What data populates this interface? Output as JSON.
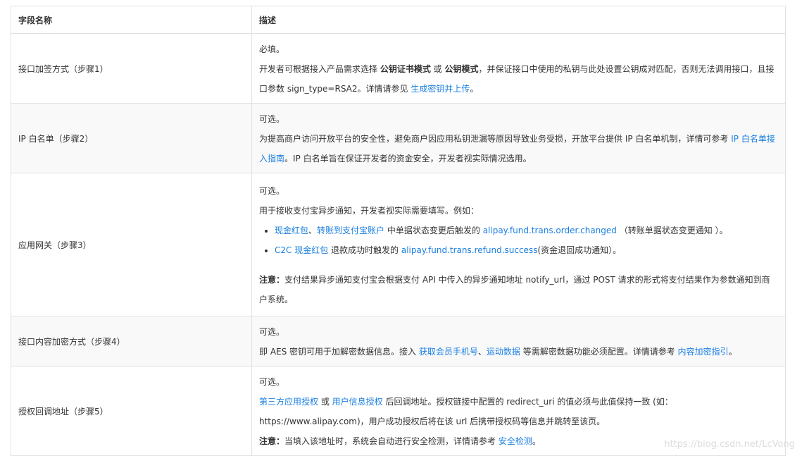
{
  "header": {
    "col_name": "字段名称",
    "col_desc": "描述"
  },
  "rows": [
    {
      "name": "接口加签方式（步骤1）",
      "line1": "必填。",
      "line2_pre": "开发者可根据接入产品需求选择 ",
      "line2_b1": "公钥证书模式",
      "line2_mid": " 或 ",
      "line2_b2": "公钥模式",
      "line2_post": "，并保证接口中使用的私钥与此处设置公钥成对匹配，否则无法调用接口，且接口参数 sign_type=RSA2。详情请参见 ",
      "link": "生成密钥并上传",
      "line2_end": "。"
    },
    {
      "name": "IP 白名单（步骤2）",
      "line1": "可选。",
      "line2_pre": "为提高商户访问开放平台的安全性，避免商户因应用私钥泄漏等原因导致业务受损，开放平台提供 IP 白名单机制，详情可参考 ",
      "link": "IP 白名单接入指南",
      "line2_post": "。IP 白名单旨在保证开发者的资金安全，开发者视实际情况选用。"
    },
    {
      "name": "应用网关（步骤3）",
      "line1": "可选。",
      "line2": "用于接收支付宝异步通知，开发者视实际需要填写。例如：",
      "bullet1_link1": "现金红包",
      "bullet1_sep": "、",
      "bullet1_link2": "转账到支付宝账户",
      "bullet1_mid": " 中单据状态变更后触发的 ",
      "bullet1_link3": "alipay.fund.trans.order.changed",
      "bullet1_post": " （转账单据状态变更通知 ）。",
      "bullet2_link1": "C2C 现金红包",
      "bullet2_mid": " 退款成功时触发的 ",
      "bullet2_link2": "alipay.fund.trans.refund.success",
      "bullet2_post": "(资金退回成功通知）。",
      "note_label": "注意：",
      "note_text": "支付结果异步通知支付宝会根据支付 API 中传入的异步通知地址 notify_url，通过 POST 请求的形式将支付结果作为参数通知到商户系统。"
    },
    {
      "name": "接口内容加密方式（步骤4）",
      "line1": "可选。",
      "line2_pre": "即 AES 密钥可用于加解密数据信息。接入 ",
      "link1": "获取会员手机号",
      "sep": "、",
      "link2": "运动数据",
      "line2_mid": " 等需解密数据功能必须配置。详情请参考 ",
      "link3": "内容加密指引",
      "line2_end": "。"
    },
    {
      "name": "授权回调地址（步骤5）",
      "line1": "可选。",
      "link1": "第三方应用授权",
      "mid1": " 或 ",
      "link2": "用户信息授权",
      "line2_post": " 后回调地址。授权链接中配置的 redirect_uri 的值必须与此值保持一致 (如：https://www.alipay.com)，用户成功授权后将在该 url 后携带授权码等信息并跳转至该页。",
      "note_label": "注意：",
      "note_text": "当填入该地址时，系统会自动进行安全检测，详情请参考 ",
      "note_link": "安全检测",
      "note_end": "。"
    }
  ],
  "watermark": "https://blog.csdn.net/LcVong"
}
